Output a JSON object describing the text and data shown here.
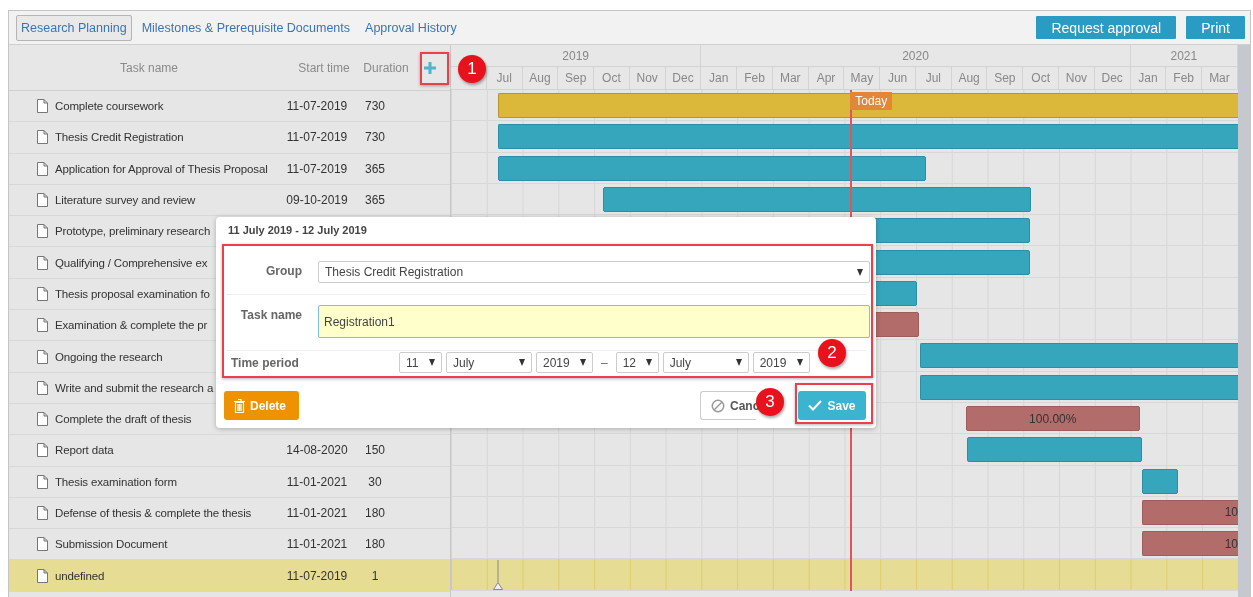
{
  "tabs": [
    {
      "label": "Research Planning",
      "selected": true
    },
    {
      "label": "Milestones & Prerequisite Documents",
      "selected": false
    },
    {
      "label": "Approval History",
      "selected": false
    }
  ],
  "actions": [
    {
      "label": "Request approval"
    },
    {
      "label": "Print"
    }
  ],
  "grid": {
    "columns": [
      {
        "label": "Task name"
      },
      {
        "label": "Start time"
      },
      {
        "label": "Duration"
      }
    ]
  },
  "timeline": {
    "years": [
      {
        "label": "2019",
        "months": [
          "Jul",
          "Aug",
          "Sep",
          "Oct",
          "Nov",
          "Dec"
        ]
      },
      {
        "label": "2020",
        "months": [
          "Jan",
          "Feb",
          "Mar",
          "Apr",
          "May",
          "Jun",
          "Jul",
          "Aug",
          "Sep",
          "Oct",
          "Nov",
          "Dec"
        ]
      },
      {
        "label": "2021",
        "months": [
          "Jan",
          "Feb",
          "Mar"
        ]
      }
    ],
    "today": {
      "label": "Today"
    }
  },
  "rows": [
    {
      "name": "Complete coursework",
      "start_time": "11-07-2019",
      "duration": "730",
      "selected": false,
      "bar": {
        "kind": "summary"
      }
    },
    {
      "name": "Thesis Credit Registration",
      "start_time": "11-07-2019",
      "duration": "730",
      "selected": false,
      "bar": {
        "kind": "task"
      }
    },
    {
      "name": "Application for Approval of Thesis Proposal",
      "start_time": "11-07-2019",
      "duration": "365",
      "selected": false,
      "bar": {
        "kind": "task"
      }
    },
    {
      "name": "Literature survey and review",
      "start_time": "09-10-2019",
      "duration": "365",
      "selected": false,
      "bar": {
        "kind": "task"
      }
    },
    {
      "name": "Prototype, preliminary research",
      "selected": false,
      "bar": {
        "kind": "task"
      }
    },
    {
      "name": "Qualifying / Comprehensive ex",
      "selected": false,
      "bar": {
        "kind": "task"
      }
    },
    {
      "name": "Thesis proposal examination fo",
      "selected": false,
      "bar": {
        "kind": "task"
      }
    },
    {
      "name": "Examination & complete the pr",
      "selected": false,
      "bar": {
        "kind": "done"
      }
    },
    {
      "name": "Ongoing the research",
      "selected": false,
      "bar": {
        "kind": "task"
      }
    },
    {
      "name": "Write and submit the research a",
      "selected": false,
      "bar": {
        "kind": "task"
      }
    },
    {
      "name": "Complete the draft of thesis",
      "selected": false,
      "bar": {
        "kind": "done",
        "label": "100.00%"
      }
    },
    {
      "name": "Report data",
      "start_time": "14-08-2020",
      "duration": "150",
      "selected": false,
      "bar": {
        "kind": "task"
      }
    },
    {
      "name": "Thesis examination form",
      "start_time": "11-01-2021",
      "duration": "30",
      "selected": false,
      "bar": {
        "kind": "task"
      }
    },
    {
      "name": "Defense of thesis & complete the thesis",
      "start_time": "11-01-2021",
      "duration": "180",
      "selected": false,
      "bar": {
        "kind": "done",
        "label": "10"
      }
    },
    {
      "name": "Submission Document",
      "start_time": "11-01-2021",
      "duration": "180",
      "selected": false,
      "bar": {
        "kind": "done",
        "label": "10"
      }
    },
    {
      "name": "undefined",
      "start_time": "11-07-2019",
      "duration": "1",
      "selected": true,
      "bar": {
        "kind": "marker"
      }
    }
  ],
  "dialog": {
    "title": "11 July 2019 - 12 July 2019",
    "group": {
      "label": "Group",
      "value": "Thesis Credit Registration"
    },
    "task_name": {
      "label": "Task name",
      "value": "Registration1"
    },
    "time_period": {
      "label": "Time period",
      "from": [
        "11",
        "July",
        "2019"
      ],
      "separator": "–",
      "to": [
        "12",
        "July",
        "2019"
      ]
    },
    "buttons": [
      {
        "kind": "delete",
        "label": "Delete"
      },
      {
        "kind": "cancel",
        "label": "Canc"
      },
      {
        "kind": "save",
        "label": "Save"
      }
    ]
  },
  "callouts": [
    {
      "label": "1"
    },
    {
      "label": "2"
    },
    {
      "label": "3"
    }
  ]
}
